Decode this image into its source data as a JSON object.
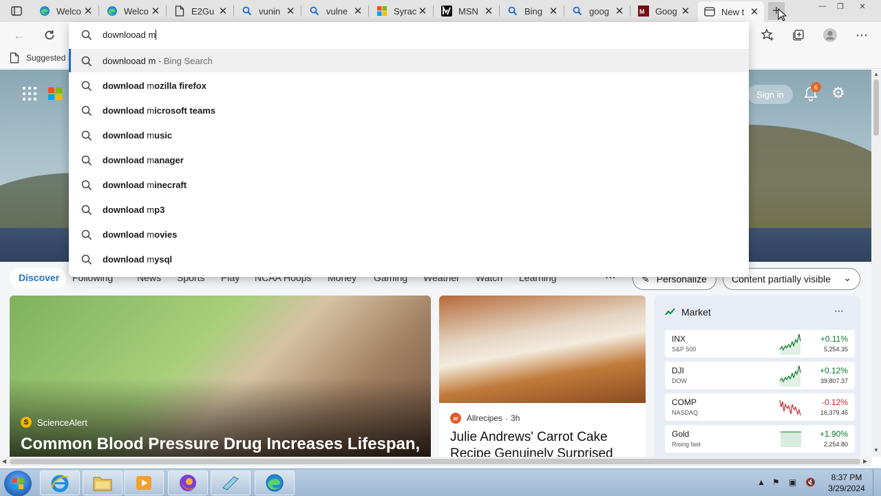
{
  "tabs": [
    {
      "title": "Welco",
      "icon": "edge-icon"
    },
    {
      "title": "Welco",
      "icon": "edge-icon"
    },
    {
      "title": "E2Gu",
      "icon": "document-icon"
    },
    {
      "title": "vunin",
      "icon": "search-icon"
    },
    {
      "title": "vulne",
      "icon": "search-icon"
    },
    {
      "title": "Syrac",
      "icon": "microsoft-icon"
    },
    {
      "title": "MSN",
      "icon": "msn-icon"
    },
    {
      "title": "Bing",
      "icon": "search-icon"
    },
    {
      "title": "goog",
      "icon": "search-icon"
    },
    {
      "title": "Goog",
      "icon": "mm-icon"
    },
    {
      "title": "New t",
      "icon": "newtab-icon",
      "active": true
    }
  ],
  "favorites": {
    "label": "Suggested S"
  },
  "omnibox": {
    "query": "downlooad m",
    "suggestions": [
      {
        "bold": "downlooad m",
        "rest": "",
        "suffix": " - Bing Search",
        "selected": true
      },
      {
        "bold": "download ",
        "rest": "m",
        "tail": "ozilla firefox"
      },
      {
        "bold": "download ",
        "rest": "m",
        "tail": "icrosoft teams"
      },
      {
        "bold": "download ",
        "rest": "m",
        "tail": "usic"
      },
      {
        "bold": "download ",
        "rest": "m",
        "tail": "anager"
      },
      {
        "bold": "download ",
        "rest": "m",
        "tail": "inecraft"
      },
      {
        "bold": "download ",
        "rest": "m",
        "tail": "p3"
      },
      {
        "bold": "download ",
        "rest": "m",
        "tail": "ovies"
      },
      {
        "bold": "download ",
        "rest": "m",
        "tail": "ysql"
      }
    ]
  },
  "header": {
    "sign_in": "Sign in",
    "notifications": "6"
  },
  "nav": {
    "items": [
      "Discover",
      "Following",
      "News",
      "Sports",
      "Play",
      "NCAA Hoops",
      "Money",
      "Gaming",
      "Weather",
      "Watch",
      "Learning"
    ],
    "personalize": "Personalize",
    "content_visibility": "Content partially visible"
  },
  "cards": {
    "big": {
      "source": "ScienceAlert",
      "source_initial": "S",
      "headline": "Common Blood Pressure Drug Increases Lifespan,"
    },
    "mid": {
      "source": "Allrecipes",
      "source_initial": "ar",
      "age": "3h",
      "headline": "Julie Andrews' Carrot Cake Recipe Genuinely Surprised"
    }
  },
  "market": {
    "title": "Market",
    "stocks": [
      {
        "symbol": "INX",
        "name": "S&P 500",
        "change": "+0.11%",
        "value": "5,254.35",
        "dir": "up"
      },
      {
        "symbol": "DJI",
        "name": "DOW",
        "change": "+0.12%",
        "value": "39,807.37",
        "dir": "up"
      },
      {
        "symbol": "COMP",
        "name": "NASDAQ",
        "change": "-0.12%",
        "value": "16,379.46",
        "dir": "down"
      },
      {
        "symbol": "Gold",
        "name": "Rising fast",
        "change": "+1.90%",
        "value": "2,254.80",
        "dir": "up"
      }
    ]
  },
  "taskbar": {
    "time": "8:37 PM",
    "date": "3/29/2024"
  },
  "colors": {
    "accent": "#1a6ad1",
    "up": "#0a7a2a",
    "down": "#c4262e",
    "discover": "#1a73c7"
  }
}
